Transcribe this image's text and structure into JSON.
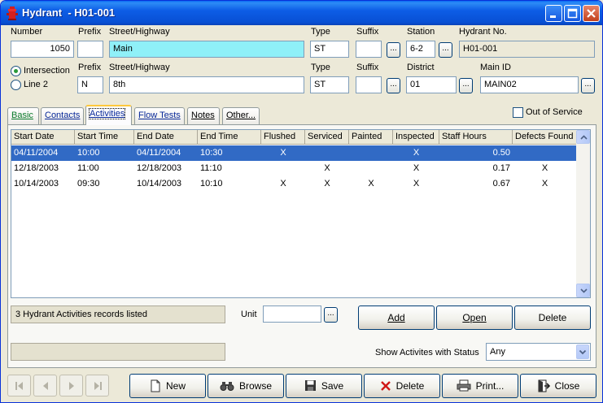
{
  "window": {
    "title": "Hydrant  - H01-001",
    "accent": "#0a5ae0"
  },
  "address1": {
    "number_label": "Number",
    "number": "1050",
    "prefix_label": "Prefix",
    "prefix": "",
    "street_label": "Street/Highway",
    "street": "Main",
    "type_label": "Type",
    "type": "ST",
    "suffix_label": "Suffix",
    "suffix": "",
    "station_label": "Station",
    "station": "6-2",
    "hydrant_no_label": "Hydrant No.",
    "hydrant_no": "H01-001"
  },
  "location_mode": {
    "intersection_label": "Intersection",
    "line2_label": "Line 2",
    "selected": "Intersection"
  },
  "address2": {
    "prefix_label": "Prefix",
    "prefix": "N",
    "street_label": "Street/Highway",
    "street": "8th",
    "type_label": "Type",
    "type": "ST",
    "suffix_label": "Suffix",
    "suffix": "",
    "district_label": "District",
    "district": "01",
    "main_id_label": "Main ID",
    "main_id": "MAIN02"
  },
  "ellipsis": "...",
  "tabs": [
    {
      "label": "Basic",
      "color": "#0a7a2a"
    },
    {
      "label": "Contacts",
      "color": "#0a2a9a"
    },
    {
      "label": "Activities",
      "color": "#0a2a9a"
    },
    {
      "label": "Flow Tests",
      "color": "#0a2a9a"
    },
    {
      "label": "Notes",
      "color": "#000000"
    },
    {
      "label": "Other...",
      "color": "#000000"
    }
  ],
  "active_tab": "Activities",
  "out_of_service_label": "Out of Service",
  "grid": {
    "columns": [
      "Start Date",
      "Start Time",
      "End Date",
      "End Time",
      "Flushed",
      "Serviced",
      "Painted",
      "Inspected",
      "Staff Hours",
      "Defects Found"
    ],
    "rows": [
      {
        "start_date": "04/11/2004",
        "start_time": "10:00",
        "end_date": "04/11/2004",
        "end_time": "10:30",
        "flushed": "X",
        "serviced": "",
        "painted": "",
        "inspected": "X",
        "staff_hours": "0.50",
        "defects": "",
        "selected": true
      },
      {
        "start_date": "12/18/2003",
        "start_time": "11:00",
        "end_date": "12/18/2003",
        "end_time": "11:10",
        "flushed": "",
        "serviced": "X",
        "painted": "",
        "inspected": "X",
        "staff_hours": "0.17",
        "defects": "X",
        "selected": false
      },
      {
        "start_date": "10/14/2003",
        "start_time": "09:30",
        "end_date": "10/14/2003",
        "end_time": "10:10",
        "flushed": "X",
        "serviced": "X",
        "painted": "X",
        "inspected": "X",
        "staff_hours": "0.67",
        "defects": "X",
        "selected": false
      }
    ]
  },
  "records_status": "3 Hydrant Activities records listed",
  "status2": "",
  "unit_label": "Unit",
  "unit": "",
  "actions": {
    "add": "Add",
    "open": "Open",
    "delete": "Delete"
  },
  "filter": {
    "label": "Show Activites with Status",
    "value": "Any"
  },
  "toolbar": {
    "new": "New",
    "browse": "Browse",
    "save": "Save",
    "delete": "Delete",
    "print": "Print...",
    "close": "Close"
  },
  "icons": {
    "title": "hydrant-icon",
    "first": "first-record-icon",
    "prev": "previous-record-icon",
    "next": "next-record-icon",
    "last": "last-record-icon",
    "new": "new-document-icon",
    "browse": "binoculars-icon",
    "save": "floppy-disk-icon",
    "delete": "red-x-icon",
    "print": "printer-icon",
    "close": "exit-door-icon"
  }
}
